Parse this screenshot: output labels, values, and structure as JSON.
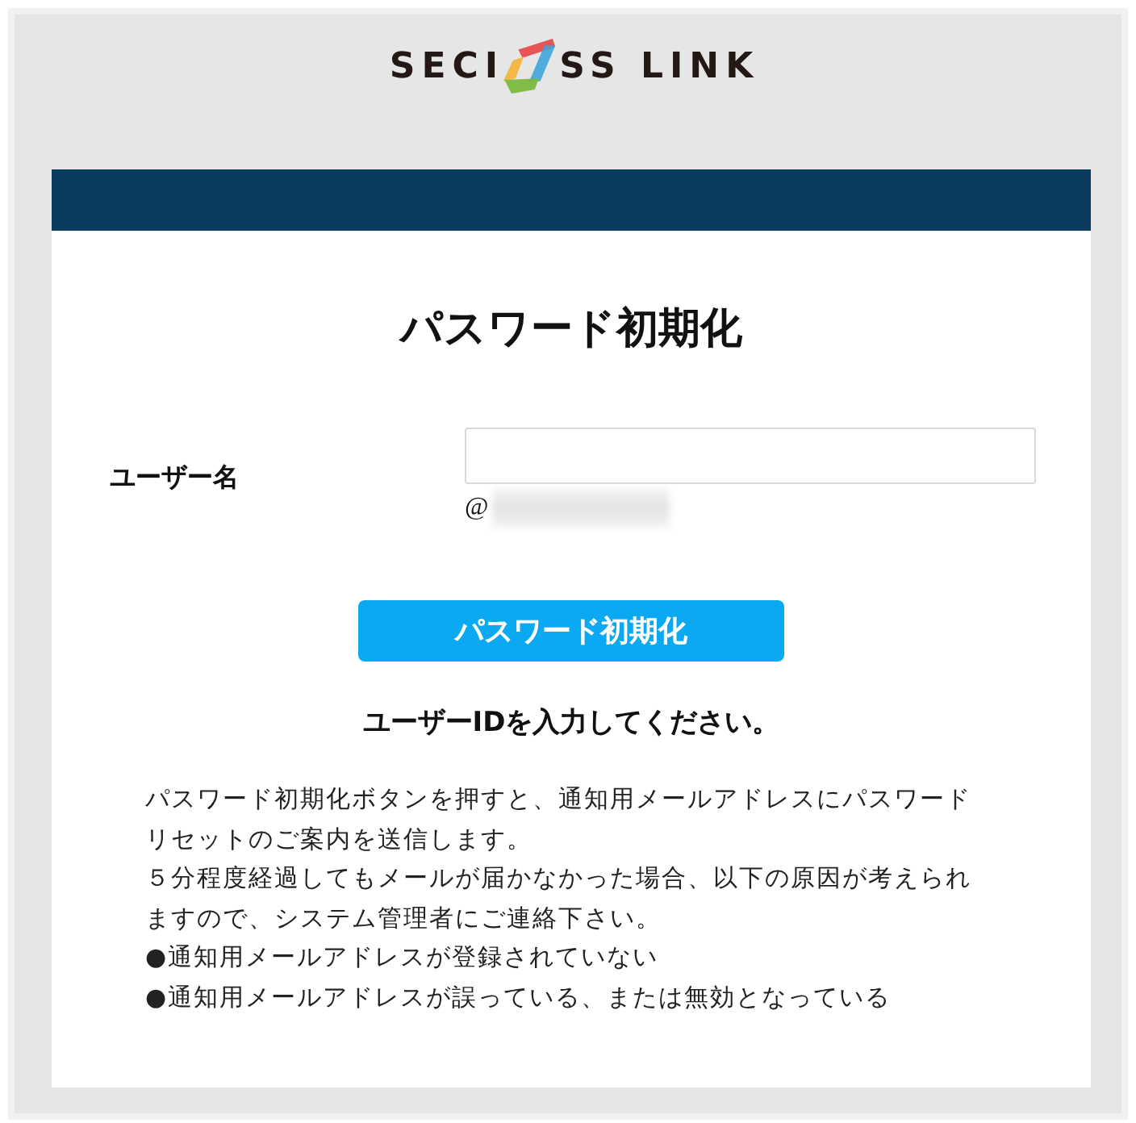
{
  "logo": {
    "text_before": "SECI",
    "text_after": "SS LINK"
  },
  "page_title": "パスワード初期化",
  "username_field": {
    "label": "ユーザー名",
    "suffix": "@"
  },
  "submit_button": {
    "label": "パスワード初期化"
  },
  "instruction": "ユーザーIDを入力してください。",
  "notes": [
    "パスワード初期化ボタンを押すと、通知用メールアドレスにパスワードリセットのご案内を送信します。",
    "５分程度経過してもメールが届かなかった場合、以下の原因が考えられますので、システム管理者にご連絡下さい。",
    "●通知用メールアドレスが登録されていない",
    "●通知用メールアドレスが誤っている、または無効となっている"
  ]
}
